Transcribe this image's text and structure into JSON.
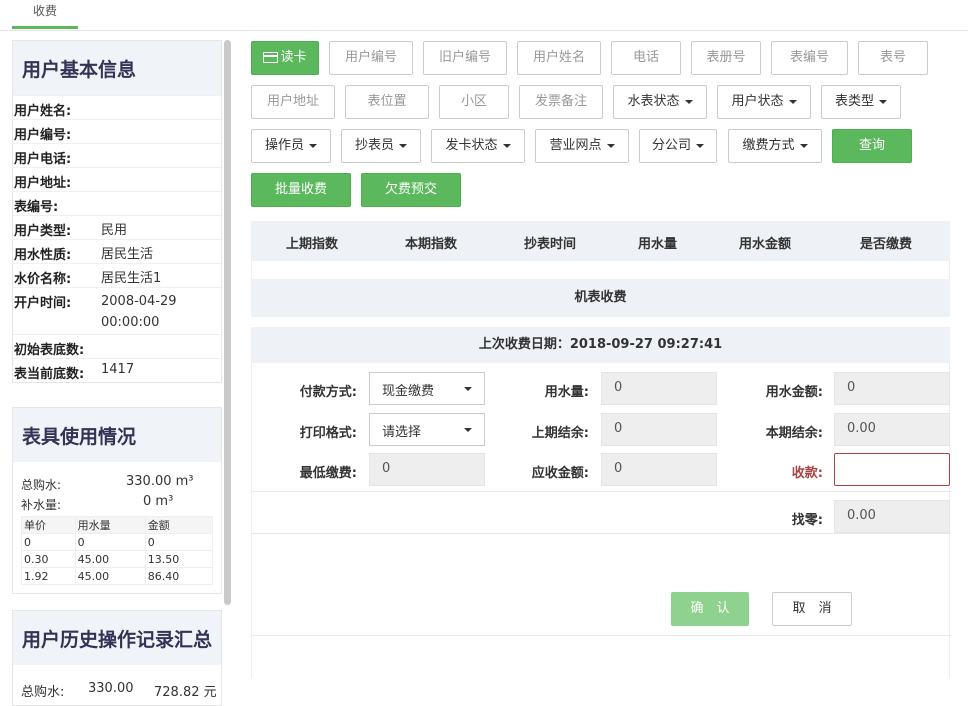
{
  "tab": {
    "label": "收费"
  },
  "user_info": {
    "title": "用户基本信息",
    "rows": [
      {
        "label": "用户姓名:",
        "value": ""
      },
      {
        "label": "用户编号:",
        "value": ""
      },
      {
        "label": "用户电话:",
        "value": ""
      },
      {
        "label": "用户地址:",
        "value": ""
      },
      {
        "label": "表编号:",
        "value": ""
      },
      {
        "label": "用户类型:",
        "value": "民用"
      },
      {
        "label": "用水性质:",
        "value": "居民生活"
      },
      {
        "label": "水价名称:",
        "value": "居民生活1"
      },
      {
        "label": "开户时间:",
        "value": "2008-04-29 00:00:00"
      },
      {
        "label": "初始表底数:",
        "value": ""
      },
      {
        "label": "表当前底数:",
        "value": "1417"
      }
    ]
  },
  "meter_usage": {
    "title": "表具使用情况",
    "total_purchase_label": "总购水:",
    "total_purchase_value": "330.00 m³",
    "supplement_label": "补水量:",
    "supplement_value": "0 m³",
    "table_headers": [
      "单价",
      "用水量",
      "金额"
    ],
    "table_rows": [
      [
        "0",
        "0",
        "0"
      ],
      [
        "0.30",
        "45.00",
        "13.50"
      ],
      [
        "1.92",
        "45.00",
        "86.40"
      ]
    ]
  },
  "history": {
    "title": "用户历史操作记录汇总",
    "label": "总购水:",
    "qty": "330.00",
    "amount": "728.82 元"
  },
  "toolbar": {
    "read_card": "读卡",
    "placeholders": [
      "用户编号",
      "旧户编号",
      "用户姓名",
      "电话",
      "表册号",
      "表编号",
      "表号",
      "用户地址",
      "表位置",
      "小区",
      "发票备注"
    ],
    "dropdowns": [
      "水表状态",
      "用户状态",
      "表类型",
      "操作员",
      "抄表员",
      "发卡状态",
      "营业网点",
      "分公司",
      "缴费方式"
    ],
    "query": "查询",
    "batch_charge": "批量收费",
    "prepay": "欠费预交"
  },
  "grid": {
    "headers": [
      "上期指数",
      "本期指数",
      "抄表时间",
      "用水量",
      "用水金额",
      "是否缴费"
    ]
  },
  "section_title": "机表收费",
  "last_charge": "上次收费日期：2018-09-27 09:27:41",
  "form": {
    "pay_method_label": "付款方式:",
    "pay_method_value": "现金缴费",
    "water_qty_label": "用水量:",
    "water_qty_value": "0",
    "water_amt_label": "用水金额:",
    "water_amt_value": "0",
    "print_label": "打印格式:",
    "print_value": "请选择",
    "prev_balance_label": "上期结余:",
    "prev_balance_value": "0",
    "cur_balance_label": "本期结余:",
    "cur_balance_value": "0.00",
    "min_pay_label": "最低缴费:",
    "min_pay_value": "0",
    "due_label": "应收金额:",
    "due_value": "0",
    "receive_label": "收款:",
    "change_label": "找零:",
    "change_value": "0.00"
  },
  "buttons": {
    "confirm": "确　认",
    "cancel": "取　消"
  },
  "colors": {
    "primary": "#5cb85c",
    "error": "#a94442",
    "panel": "#eef1f6"
  }
}
